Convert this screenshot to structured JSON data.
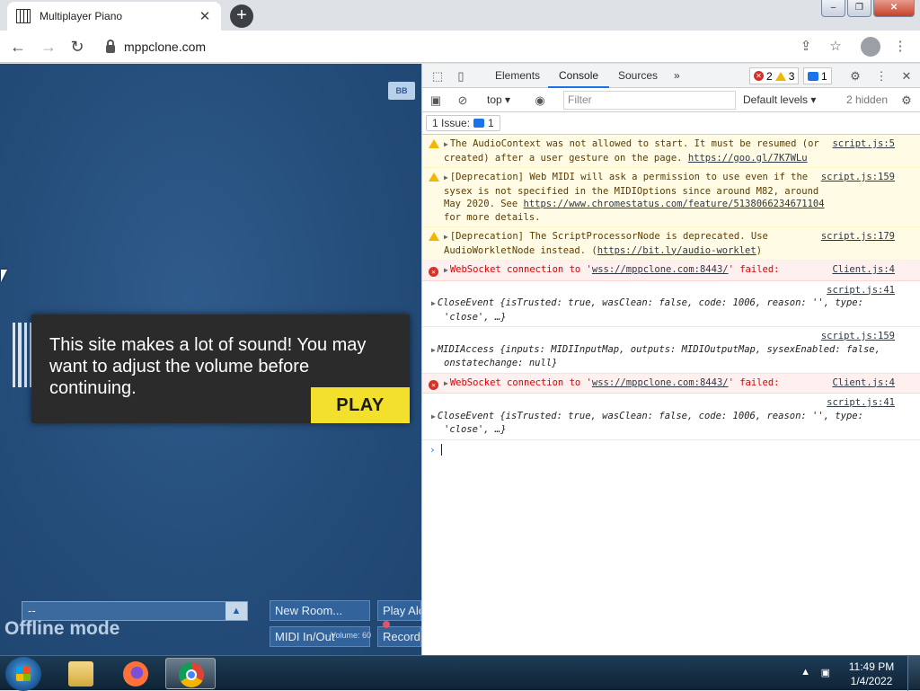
{
  "browser": {
    "tab_title": "Multiplayer Piano",
    "url": "mppclone.com"
  },
  "page": {
    "chat_toggle": "BB",
    "modal_text": "This site makes a lot of sound! You may want to adjust the volume before continuing.",
    "play_label": "PLAY",
    "room_select_value": "--",
    "new_room_label": "New Room...",
    "play_alone_label": "Play Alo",
    "midi_label": "MIDI In/Out",
    "volume_label": "Volume: 60",
    "record_label": "Record",
    "offline_label": "Offline mode"
  },
  "devtools": {
    "tabs": [
      "Elements",
      "Console",
      "Sources"
    ],
    "more_tabs": "»",
    "error_count": "2",
    "warning_count": "3",
    "info_count": "1",
    "context": "top",
    "filter_placeholder": "Filter",
    "levels": "Default levels",
    "hidden": "2 hidden",
    "issues_label": "1 Issue:",
    "issues_count": "1",
    "messages": [
      {
        "level": "warning",
        "src": "script.js:5",
        "text_a": "The AudioContext was not allowed to start. It must be resumed (or created) after a user gesture on the page. ",
        "link": "https://goo.gl/7K7WLu",
        "text_b": ""
      },
      {
        "level": "warning",
        "src": "script.js:159",
        "text_a": "[Deprecation] Web MIDI will ask a permission to use even if the sysex is not specified in the MIDIOptions since around M82, around May 2020. See ",
        "link": "https://www.chromestatus.com/feature/5138066234671104",
        "text_b": " for more details."
      },
      {
        "level": "warning",
        "src": "script.js:179",
        "text_a": "[Deprecation] The ScriptProcessorNode is deprecated. Use AudioWorkletNode instead. (",
        "link": "https://bit.ly/audio-worklet",
        "text_b": ")"
      },
      {
        "level": "error",
        "src": "Client.js:4",
        "text_a": "WebSocket connection to '",
        "link": "wss://mppclone.com:8443/",
        "text_b": "' failed:"
      },
      {
        "level": "log",
        "src": "script.js:41",
        "text": "CloseEvent {isTrusted: true, wasClean: false, code: 1006, reason: '', type: 'close', …}"
      },
      {
        "level": "log",
        "src": "script.js:159",
        "text": "MIDIAccess {inputs: MIDIInputMap, outputs: MIDIOutputMap, sysexEnabled: false, onstatechange: null}"
      },
      {
        "level": "error",
        "src": "Client.js:4",
        "text_a": "WebSocket connection to '",
        "link": "wss://mppclone.com:8443/",
        "text_b": "' failed:"
      },
      {
        "level": "log",
        "src": "script.js:41",
        "text": "CloseEvent {isTrusted: true, wasClean: false, code: 1006, reason: '', type: 'close', …}"
      }
    ],
    "prompt": "›"
  },
  "taskbar": {
    "time": "11:49 PM",
    "date": "1/4/2022"
  },
  "colors": {
    "page_bg": "#2a5486",
    "play_button": "#f2e02c",
    "devtools_accent": "#1a73e8"
  }
}
